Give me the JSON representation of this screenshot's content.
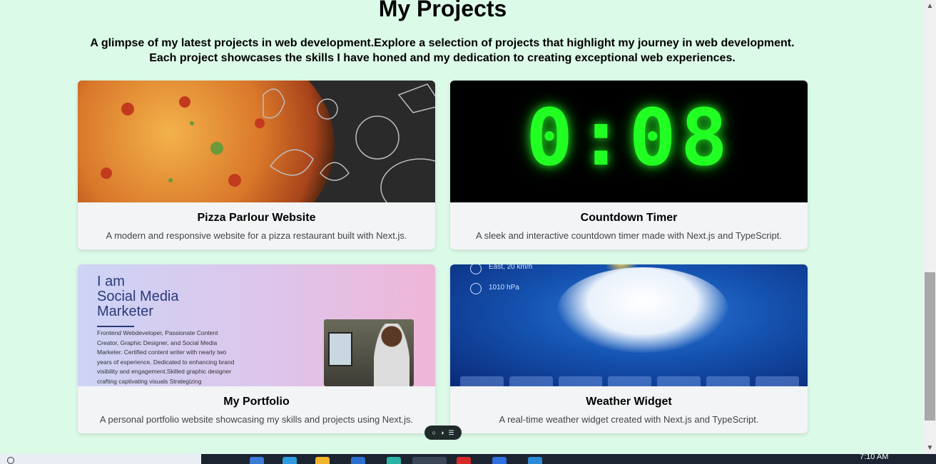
{
  "section": {
    "title": "My Projects",
    "intro": "A glimpse of my latest projects in web development.Explore a selection of projects that highlight my journey in web development. Each project showcases the skills I have honed and my dedication to creating exceptional web experiences."
  },
  "projects": [
    {
      "name": "Pizza Parlour Website",
      "description": "A modern and responsive website for a pizza restaurant built with Next.js."
    },
    {
      "name": "Countdown Timer",
      "description": "A sleek and interactive countdown timer made with Next.js and TypeScript.",
      "image_text": "0:08"
    },
    {
      "name": "My Portfolio",
      "description": "A personal portfolio website showcasing my skills and projects using Next.js.",
      "image_text": {
        "heading_1": "I am",
        "heading_2": "Social Media",
        "heading_3": "Marketer",
        "body": "Frontend Webdeveloper, Passionate Content Creator, Graphic Designer, and Social Media Marketer. Certified content writer with nearly two years of experience. Dedicated to enhancing brand visibility and engagement.Skilled graphic designer crafting captivating visuals Strategizing"
      }
    },
    {
      "name": "Weather Widget",
      "description": "A real-time weather widget created with Next.js and TypeScript.",
      "image_text": {
        "wind": "East, 20 km/h",
        "pressure": "1010 hPa"
      }
    }
  ],
  "floating_toolbar": {
    "icons": [
      "comment-icon",
      "toggle-icon",
      "menu-icon"
    ]
  },
  "taskbar": {
    "time": "7:10 AM"
  },
  "colors": {
    "page_bg": "#dcfae8",
    "card_bg": "#f3f4f6",
    "timer_digits": "#22ff22",
    "taskbar_dark": "#1b2430"
  }
}
